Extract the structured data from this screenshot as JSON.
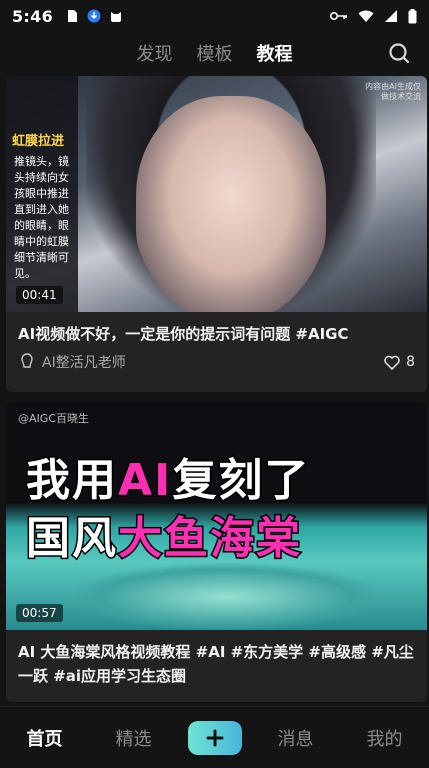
{
  "status": {
    "time": "5:46"
  },
  "top_nav": {
    "tabs": [
      "发现",
      "模板",
      "教程"
    ],
    "active": 2
  },
  "cards": [
    {
      "side_title": "虹膜拉进",
      "side_text": "推镜头，镜头持续向女孩眼中推进直到进入她的眼睛，眼睛中的虹膜细节清晰可见。",
      "watermark": "内容由AI生成仅做技术交流",
      "duration": "00:41",
      "title": "AI视频做不好，一定是你的提示词有问题 #AIGC",
      "author": "AI整活凡老师",
      "likes": "8"
    },
    {
      "handle": "@AIGC百晓生",
      "line1_a": "我用",
      "line1_b": "AI",
      "line1_c": "复刻了",
      "line2_a": "国风",
      "line2_b": "大鱼海棠",
      "duration": "00:57",
      "title": "AI 大鱼海棠风格视频教程 #AI #东方美学 #高级感 #凡尘一跃 #ai应用学习生态圈"
    }
  ],
  "bottom_nav": {
    "items": [
      "首页",
      "精选",
      "消息",
      "我的"
    ]
  },
  "colors": {
    "accent": "#5fd3d6",
    "highlight_pink": "#ff2fb4",
    "side_title_yellow": "#ffd84a"
  }
}
